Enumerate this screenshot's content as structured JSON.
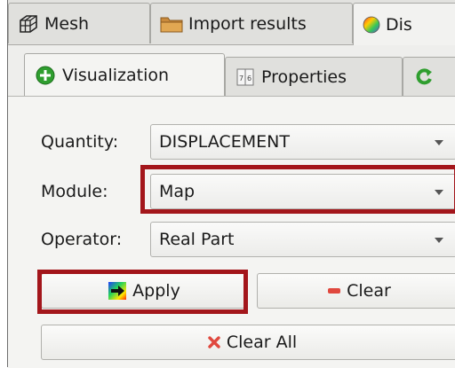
{
  "outer_tabs": [
    {
      "label": "Mesh",
      "icon": "mesh-icon"
    },
    {
      "label": "Import results",
      "icon": "folder-icon"
    },
    {
      "label": "Dis",
      "icon": "color-wheel-icon"
    }
  ],
  "inner_tabs": [
    {
      "label": "Visualization",
      "icon": "plus-circle-icon"
    },
    {
      "label": "Properties",
      "icon": "properties-icon"
    },
    {
      "label": "",
      "icon": "refresh-icon"
    }
  ],
  "form": {
    "quantity": {
      "label": "Quantity:",
      "value": "DISPLACEMENT"
    },
    "module": {
      "label": "Module:",
      "value": "Map"
    },
    "operator": {
      "label": "Operator:",
      "value": "Real Part"
    }
  },
  "buttons": {
    "apply": {
      "label": "Apply",
      "icon": "arrow-right-icon"
    },
    "clear": {
      "label": "Clear",
      "icon": "minus-icon"
    },
    "clear_all": {
      "label": "Clear All",
      "icon": "x-icon"
    }
  },
  "colors": {
    "highlight": "#a3161b",
    "green": "#2f9e2f",
    "red_minus": "#e0483e"
  }
}
